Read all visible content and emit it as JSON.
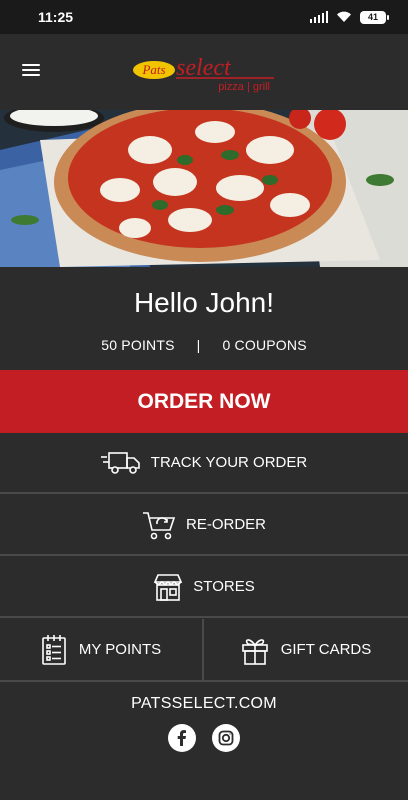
{
  "status_bar": {
    "time": "11:25",
    "battery": "41"
  },
  "header": {
    "logo": {
      "script": "Pats",
      "word": "select",
      "tagline": "pizza | grill"
    }
  },
  "greeting": "Hello John!",
  "stats": {
    "points": "50 POINTS",
    "separator": "|",
    "coupons": "0 COUPONS"
  },
  "actions": {
    "order_now": "ORDER NOW",
    "track_order": "TRACK YOUR ORDER",
    "reorder": "RE-ORDER",
    "stores": "STORES",
    "my_points": "MY POINTS",
    "gift_cards": "GIFT CARDS"
  },
  "footer": {
    "website": "PATSSELECT.COM",
    "social": [
      "facebook-icon",
      "instagram-icon"
    ]
  },
  "colors": {
    "background": "#2c2c2c",
    "accent": "#c31e24",
    "statusbar": "#1a1a1a",
    "divider": "#4a4a4a"
  }
}
